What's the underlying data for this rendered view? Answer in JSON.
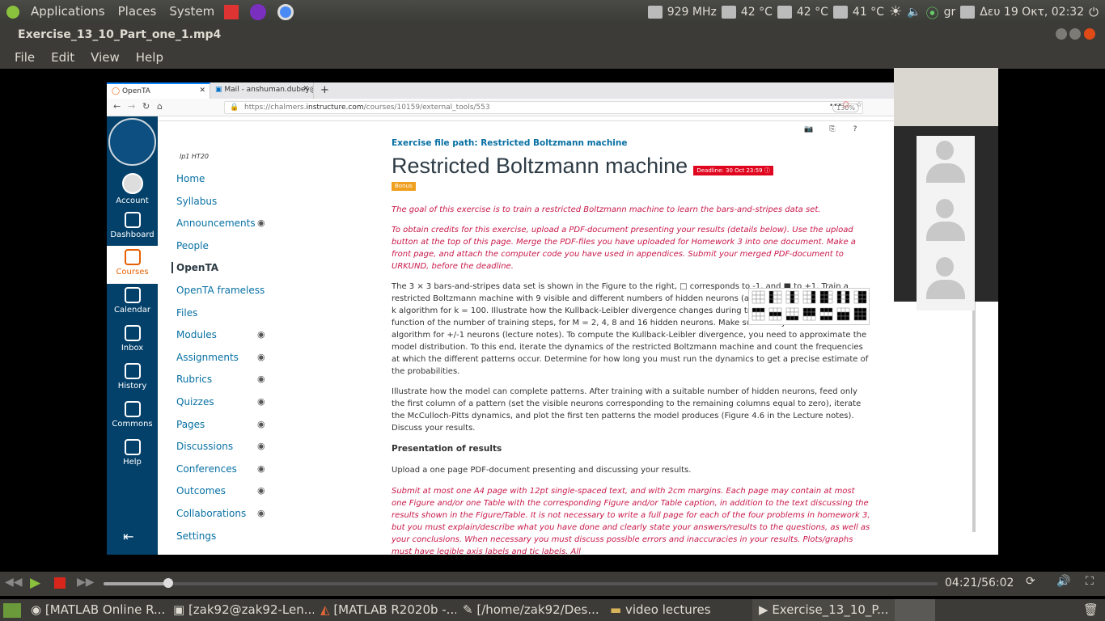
{
  "system_bar": {
    "menus": [
      "Applications",
      "Places",
      "System"
    ],
    "cpu": "929 MHz",
    "temps": [
      "42 °C",
      "42 °C",
      "41 °C"
    ],
    "keyboard": "gr",
    "datetime": "Δευ 19 Οκτ, 02:32"
  },
  "window": {
    "title": "Exercise_13_10_Part_one_1.mp4",
    "menu": [
      "File",
      "Edit",
      "View",
      "Help"
    ]
  },
  "browser": {
    "tabs": [
      "OpenTA",
      "Mail - anshuman.dubey@"
    ],
    "url_prefix": "https://chalmers.",
    "url_domain": "instructure.com",
    "url_path": "/courses/10159/external_tools/553",
    "zoom": "130%"
  },
  "canvas_nav": [
    {
      "label": "Account",
      "icon": "account-icon"
    },
    {
      "label": "Dashboard",
      "icon": "dashboard-icon"
    },
    {
      "label": "Courses",
      "icon": "courses-icon"
    },
    {
      "label": "Calendar",
      "icon": "calendar-icon"
    },
    {
      "label": "Inbox",
      "icon": "inbox-icon"
    },
    {
      "label": "History",
      "icon": "history-icon"
    },
    {
      "label": "Commons",
      "icon": "commons-icon"
    },
    {
      "label": "Help",
      "icon": "help-icon"
    }
  ],
  "term": "lp1 HT20",
  "course_nav": [
    {
      "label": "Home",
      "hidden": false
    },
    {
      "label": "Syllabus",
      "hidden": false
    },
    {
      "label": "Announcements",
      "hidden": true
    },
    {
      "label": "People",
      "hidden": false
    },
    {
      "label": "OpenTA",
      "hidden": false,
      "current": true
    },
    {
      "label": "OpenTA frameless",
      "hidden": false
    },
    {
      "label": "Files",
      "hidden": false
    },
    {
      "label": "Modules",
      "hidden": true
    },
    {
      "label": "Assignments",
      "hidden": true
    },
    {
      "label": "Rubrics",
      "hidden": true
    },
    {
      "label": "Quizzes",
      "hidden": true
    },
    {
      "label": "Pages",
      "hidden": true
    },
    {
      "label": "Discussions",
      "hidden": true
    },
    {
      "label": "Conferences",
      "hidden": true
    },
    {
      "label": "Outcomes",
      "hidden": true
    },
    {
      "label": "Collaborations",
      "hidden": true
    },
    {
      "label": "Settings",
      "hidden": false
    }
  ],
  "exercise": {
    "file_path": "Exercise file path: Restricted Boltzmann machine",
    "title": "Restricted Boltzmann machine",
    "deadline": "Deadline: 30 Oct 23:59",
    "bonus": "Bonus",
    "goal": "The goal of this exercise is to train a restricted Boltzmann machine to learn the bars-and-stripes data set.",
    "credits": "To obtain credits for this exercise, upload a PDF-document presenting your results (details below). Use the upload button at the top of this page. Merge the PDF-files you have uploaded for Homework 3 into one document. Make a front page, and attach the computer code you have used in appendices. Submit your merged PDF-document to URKUND, before the deadline.",
    "p1": "The 3 × 3 bars-and-stripes data set is shown in the Figure to the right, □ corresponds to -1, and ■ to +1. Train a restricted Boltzmann machine with 9 visible and different numbers of hidden neurons (all +/-1 neurons) using the CD-k algorithm for k = 100. Illustrate how the Kullback-Leibler divergence changes during training by plotting it as a function of the number of training steps, for M = 2, 4, 8 and 16 hidden neurons. Make sure that you use the correct algorithm for +/-1 neurons (lecture notes). To compute the Kullback-Leibler divergence, you need to approximate the model distribution. To this end, iterate the dynamics of the restricted Boltzmann machine and count the frequencies at which the different patterns occur. Determine for how long you must run the dynamics to get a precise estimate of the probabilities.",
    "p2": "Illustrate how the model can complete patterns. After training with a suitable number of hidden neurons, feed only the first column of a pattern (set the visible neurons corresponding to the remaining columns equal to zero), iterate the McCulloch-Pitts dynamics, and plot the first ten patterns the model produces (Figure 4.6 in the Lecture notes). Discuss your results.",
    "presentation_heading": "Presentation of results",
    "presentation": "Upload a one page PDF-document presenting and discussing your results.",
    "submit": "Submit at most one A4 page with 12pt single-spaced text, and with 2cm margins. Each page may contain at most one Figure and/or one Table with the corresponding Figure and/or Table caption, in addition to the text discussing the results shown in the Figure/Table. It is not necessary to write a full page for each of the four problems in homework 3, but you must explain/describe what you have done and clearly state your answers/results to the questions, as well as your conclusions. When necessary you must discuss possible errors and inaccuracies in your results. Plots/graphs must have legible axis labels and tic labels. All"
  },
  "player": {
    "time": "04:21/56:02",
    "progress": 0.0776
  },
  "taskbar": [
    "[MATLAB Online R...",
    "[zak92@zak92-Len...",
    "[MATLAB R2020b -...",
    "[/home/zak92/Des...",
    "video lectures",
    "Exercise_13_10_P..."
  ]
}
